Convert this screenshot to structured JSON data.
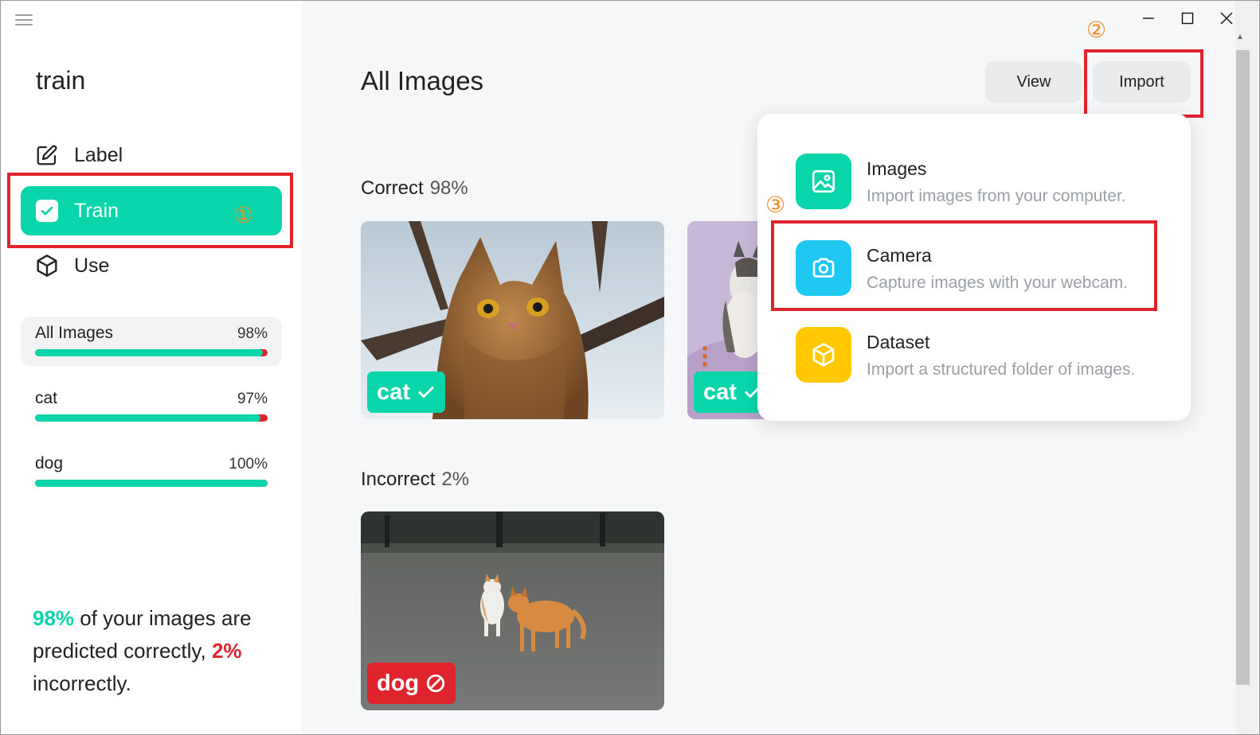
{
  "app": {
    "title": "train"
  },
  "sidebar": {
    "nav": [
      {
        "label": "Label",
        "icon": "pencil-icon"
      },
      {
        "label": "Train",
        "icon": "checkbox-icon"
      },
      {
        "label": "Use",
        "icon": "cube-icon"
      }
    ],
    "stats": [
      {
        "name": "All Images",
        "pct_label": "98%",
        "fraction": 0.98
      },
      {
        "name": "cat",
        "pct_label": "97%",
        "fraction": 0.97
      },
      {
        "name": "dog",
        "pct_label": "100%",
        "fraction": 1.0
      }
    ],
    "summary": {
      "correct_pct": "98%",
      "line1": " of your images are predicted correctly,",
      "incorrect_pct": "2%",
      "line2": " incorrectly."
    }
  },
  "main": {
    "title": "All Images",
    "buttons": {
      "view": "View",
      "import": "Import"
    },
    "sections": {
      "correct": {
        "label": "Correct",
        "pct": "98%"
      },
      "incorrect": {
        "label": "Incorrect",
        "pct": "2%"
      }
    },
    "cards": [
      {
        "tag": "cat",
        "status": "correct"
      },
      {
        "tag": "cat",
        "status": "correct"
      },
      {
        "tag": "dog",
        "status": "incorrect"
      }
    ]
  },
  "import_menu": {
    "items": [
      {
        "title": "Images",
        "desc": "Import images from your computer.",
        "icon": "image-icon",
        "color": "#08d6aa"
      },
      {
        "title": "Camera",
        "desc": "Capture images with your webcam.",
        "icon": "camera-icon",
        "color": "#1ec8f0"
      },
      {
        "title": "Dataset",
        "desc": "Import a structured folder of images.",
        "icon": "box-icon",
        "color": "#ffc800"
      }
    ]
  },
  "annotations": {
    "one": "①",
    "two": "②",
    "three": "③"
  },
  "colors": {
    "accent": "#08d6aa",
    "error": "#e0242e",
    "annotation": "#f08a24"
  }
}
